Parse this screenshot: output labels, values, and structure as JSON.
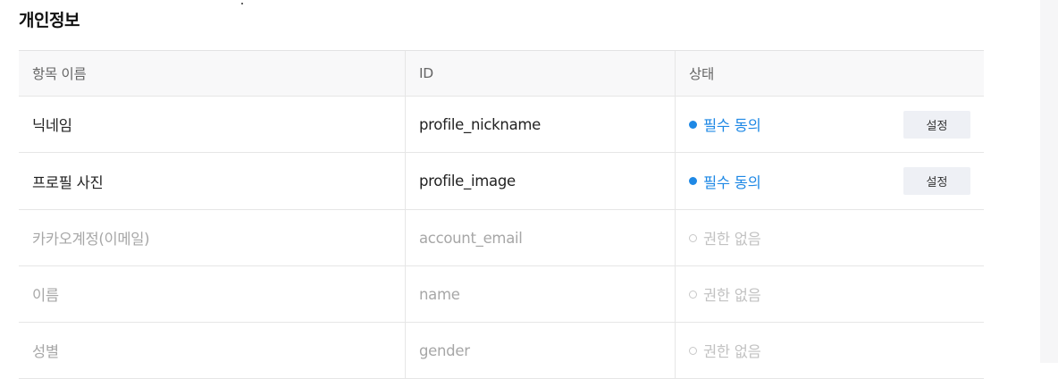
{
  "section": {
    "title": "개인정보"
  },
  "table": {
    "headers": {
      "name": "항목 이름",
      "id": "ID",
      "status": "상태"
    },
    "rows": [
      {
        "name": "닉네임",
        "id": "profile_nickname",
        "status": "필수 동의",
        "button": "설정"
      },
      {
        "name": "프로필 사진",
        "id": "profile_image",
        "status": "필수 동의",
        "button": "설정"
      },
      {
        "name": "카카오계정(이메일)",
        "id": "account_email",
        "status": "권한 없음"
      },
      {
        "name": "이름",
        "id": "name",
        "status": "권한 없음"
      },
      {
        "name": "성별",
        "id": "gender",
        "status": "권한 없음"
      }
    ]
  },
  "colors": {
    "accent": "#1e88e5",
    "disabled_text": "#a7a7a7",
    "header_bg": "#f8f8f9"
  }
}
